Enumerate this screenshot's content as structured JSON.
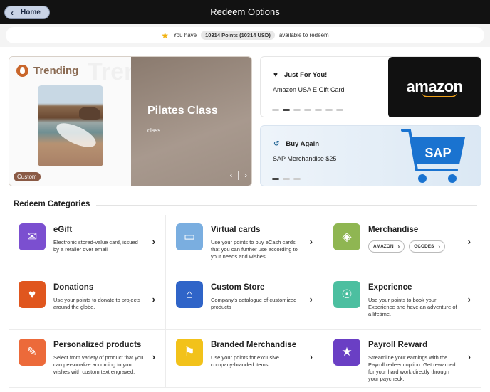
{
  "header": {
    "home_label": "Home",
    "title": "Redeem Options"
  },
  "points": {
    "prefix": "You have",
    "value": "10314 Points (10314 USD)",
    "suffix": "available to redeem"
  },
  "trending": {
    "title": "Trending",
    "ghost_text": "Tren",
    "badge": "Custom",
    "item_title": "Pilates Class",
    "item_subtitle": "class"
  },
  "just_for_you": {
    "title": "Just For You!",
    "item": "Amazon USA E Gift Card",
    "logo_text": "amazon",
    "active_dot": 1,
    "dot_count": 7
  },
  "buy_again": {
    "title": "Buy Again",
    "item": "SAP Merchandise $25",
    "logo_text": "SAP",
    "active_dot": 0,
    "dot_count": 3
  },
  "categories_title": "Redeem Categories",
  "categories": [
    {
      "title": "eGift",
      "desc": "Electronic stored-value card, issued by a retailer over email",
      "color": "#7b4fd0",
      "icon": "gift-card-icon",
      "glyph": "✉"
    },
    {
      "title": "Virtual cards",
      "desc": "Use your points to buy eCash cards that you can further use according to your needs and wishes.",
      "color": "#7aaee0",
      "icon": "virtual-card-icon",
      "glyph": "▭"
    },
    {
      "title": "Merchandise",
      "desc": "",
      "color": "#8fb652",
      "icon": "tag-icon",
      "glyph": "◈",
      "chips": [
        "AMAZON",
        "GCODES"
      ]
    },
    {
      "title": "Donations",
      "desc": "Use your points to donate to projects around the globe.",
      "color": "#e0561e",
      "icon": "donate-hand-icon",
      "glyph": "♥"
    },
    {
      "title": "Custom Store",
      "desc": "Company's catalogue of customized products",
      "color": "#2f64c8",
      "icon": "store-icon",
      "glyph": "⌂"
    },
    {
      "title": "Experience",
      "desc": "Use your points to book your Experience and have an adventure of a lifetime.",
      "color": "#4cbfa0",
      "icon": "compass-icon",
      "glyph": "☉"
    },
    {
      "title": "Personalized products",
      "desc": "Select from variety of product that you can personalize according to your wishes with custom text engraved.",
      "color": "#ec6a3a",
      "icon": "personalize-icon",
      "glyph": "✎"
    },
    {
      "title": "Branded Merchandise",
      "desc": "Use your points for exclusive company-branded items.",
      "color": "#f2c21a",
      "icon": "tshirt-icon",
      "glyph": "⚑"
    },
    {
      "title": "Payroll Reward",
      "desc": "Streamline your earnings with the Payroll redeem option. Get rewarded for your hard work directly through your paycheck.",
      "color": "#6a3fc4",
      "icon": "payroll-star-icon",
      "glyph": "★"
    }
  ]
}
